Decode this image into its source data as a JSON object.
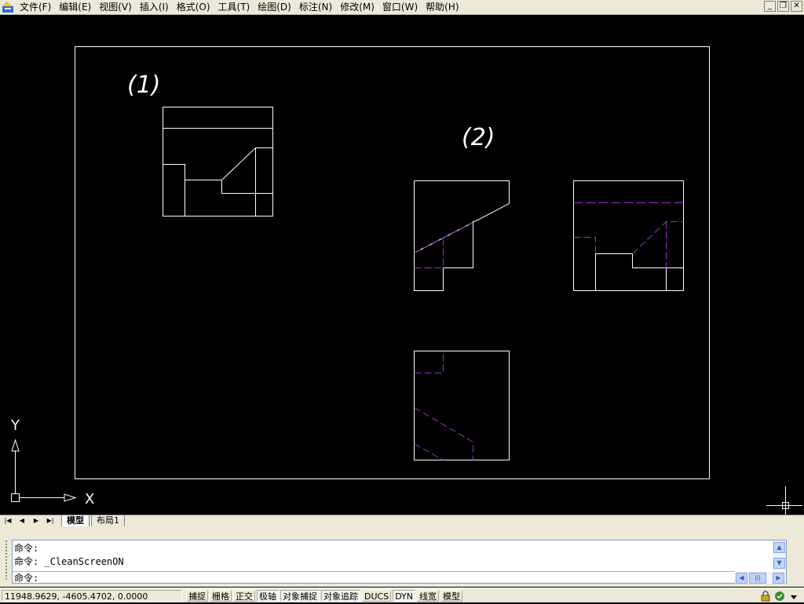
{
  "menubar": {
    "app_icon": "autocad-app-icon",
    "items": [
      "文件(F)",
      "编辑(E)",
      "视图(V)",
      "插入(I)",
      "格式(O)",
      "工具(T)",
      "绘图(D)",
      "标注(N)",
      "修改(M)",
      "窗口(W)",
      "帮助(H)"
    ],
    "window_buttons": [
      "minimize-icon",
      "restore-icon",
      "close-icon"
    ]
  },
  "drawing": {
    "label_1": "(1)",
    "label_2": "(2)",
    "ucs_x": "X",
    "ucs_y": "Y",
    "colors": {
      "background": "#000000",
      "lines": "#ffffff",
      "hidden_lines": "#9b30c8"
    }
  },
  "tabs": {
    "nav": [
      "first-tab-icon",
      "prev-tab-icon",
      "next-tab-icon",
      "last-tab-icon"
    ],
    "items": [
      {
        "label": "模型",
        "active": true
      },
      {
        "label": "布局1",
        "active": false
      }
    ]
  },
  "command": {
    "lines": [
      "命令:",
      "命令: _CleanScreenON",
      "命令:"
    ]
  },
  "status": {
    "coords": "11948.9629, -4605.4702, 0.0000",
    "toggles": [
      {
        "label": "捕捉",
        "on": false
      },
      {
        "label": "栅格",
        "on": false
      },
      {
        "label": "正交",
        "on": false
      },
      {
        "label": "极轴",
        "on": true
      },
      {
        "label": "对象捕捉",
        "on": true
      },
      {
        "label": "对象追踪",
        "on": true
      },
      {
        "label": "DUCS",
        "on": false
      },
      {
        "label": "DYN",
        "on": true
      },
      {
        "label": "线宽",
        "on": false
      },
      {
        "label": "模型",
        "on": false
      }
    ],
    "tray_icons": [
      "lock-icon",
      "communication-center-icon",
      "tray-settings-arrow-icon"
    ]
  }
}
